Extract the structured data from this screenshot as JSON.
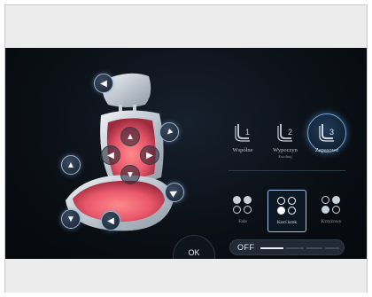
{
  "modes": [
    {
      "label": "Wspólne",
      "sub": "",
      "active": false,
      "icon": "seat-profile-1-icon"
    },
    {
      "label": "Wypoczyn",
      "sub": "Ewoluuj",
      "active": false,
      "icon": "seat-profile-2-icon"
    },
    {
      "label": "Zapasowe",
      "sub": "",
      "active": true,
      "icon": "seat-profile-3-icon"
    }
  ],
  "patterns": [
    {
      "label": "Fala",
      "active": false,
      "dots": [
        "fill",
        "fill",
        "hollow",
        "hollow"
      ]
    },
    {
      "label": "Kocí krok",
      "active": true,
      "dots": [
        "hollow",
        "hollow",
        "white",
        "hollow"
      ]
    },
    {
      "label": "Krzyżowy",
      "active": false,
      "dots": [
        "hollow",
        "fill",
        "fill",
        "hollow"
      ]
    }
  ],
  "toggle": {
    "label": "OFF",
    "level_segments_on": 1,
    "level_segments_total": 4
  },
  "ok_label": "OK",
  "seat_controls": {
    "headrest": [
      "arrow-left-icon",
      "arrow-down-right-icon"
    ],
    "backrest": [
      "arrow-up-icon",
      "arrow-left-icon",
      "arrow-right-icon",
      "arrow-down-icon"
    ],
    "cushion": [
      "arrow-up-icon",
      "arrow-down-icon",
      "arrow-down-right-icon",
      "arrow-left-icon"
    ]
  },
  "colors": {
    "accent": "#6fa6d6",
    "seat_heat": "#e2505a",
    "seat_shell": "#b9c3cc"
  }
}
